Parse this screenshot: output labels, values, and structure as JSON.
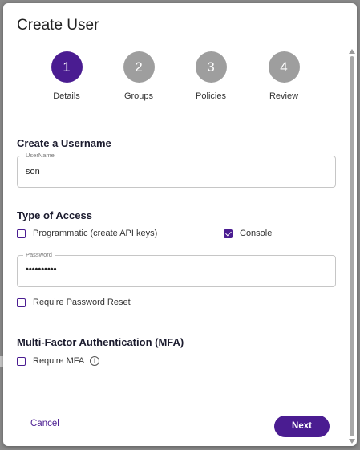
{
  "dialog": {
    "title": "Create User"
  },
  "stepper": {
    "steps": [
      {
        "number": "1",
        "label": "Details",
        "active": true
      },
      {
        "number": "2",
        "label": "Groups",
        "active": false
      },
      {
        "number": "3",
        "label": "Policies",
        "active": false
      },
      {
        "number": "4",
        "label": "Review",
        "active": false
      }
    ]
  },
  "username_section": {
    "title": "Create a Username",
    "field": {
      "label": "UserName",
      "value": "son"
    }
  },
  "access_section": {
    "title": "Type of Access",
    "programmatic": {
      "label": "Programmatic (create API keys)",
      "checked": false
    },
    "console": {
      "label": "Console",
      "checked": true
    },
    "password": {
      "label": "Password",
      "value": "••••••••••"
    },
    "require_reset": {
      "label": "Require Password Reset",
      "checked": false
    }
  },
  "mfa_section": {
    "title": "Multi-Factor Authentication (MFA)",
    "require_mfa": {
      "label": "Require MFA",
      "checked": false
    },
    "info_icon": "info-icon"
  },
  "footer": {
    "cancel_label": "Cancel",
    "next_label": "Next"
  },
  "colors": {
    "accent": "#4a1c91",
    "inactive_step": "#9e9e9e"
  }
}
